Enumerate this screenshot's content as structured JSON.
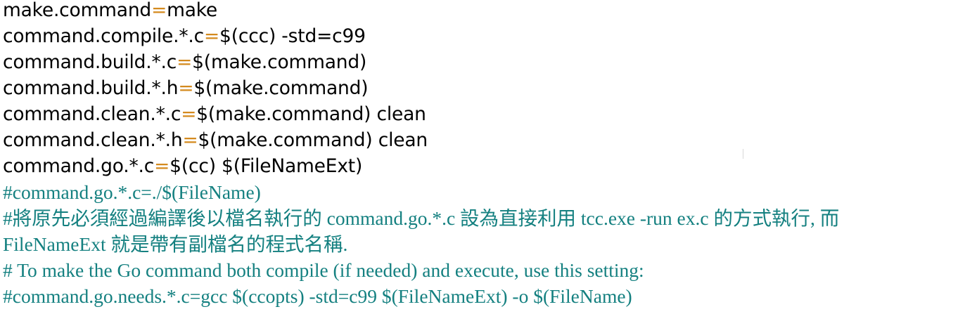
{
  "editor": {
    "settings": [
      {
        "key": "make.command",
        "op": "=",
        "value": "make"
      },
      {
        "key": "command.compile.*.c",
        "op": "=",
        "value": "$(ccc) -std=c99"
      },
      {
        "key": "command.build.*.c",
        "op": "=",
        "value": "$(make.command)"
      },
      {
        "key": "command.build.*.h",
        "op": "=",
        "value": "$(make.command)"
      },
      {
        "key": "command.clean.*.c",
        "op": "=",
        "value": "$(make.command) clean"
      },
      {
        "key": "command.clean.*.h",
        "op": "=",
        "value": "$(make.command) clean"
      },
      {
        "key": "command.go.*.c",
        "op": "=",
        "value": "$(cc) $(FileNameExt)"
      }
    ],
    "comments": [
      "#command.go.*.c=./$(FileName)",
      "#將原先必須經過編譯後以檔名執行的 command.go.*.c 設為直接利用 tcc.exe -run ex.c 的方式執行, 而",
      "FileNameExt 就是帶有副檔名的程式名稱.",
      "# To make the Go command both compile (if needed) and execute, use this setting:",
      "#command.go.needs.*.c=gcc $(ccopts) -std=c99 $(FileNameExt) -o $(FileName)"
    ],
    "colors": {
      "background": "#ffffff",
      "text": "#000000",
      "operator": "#d48a1e",
      "comment": "#148080"
    }
  }
}
